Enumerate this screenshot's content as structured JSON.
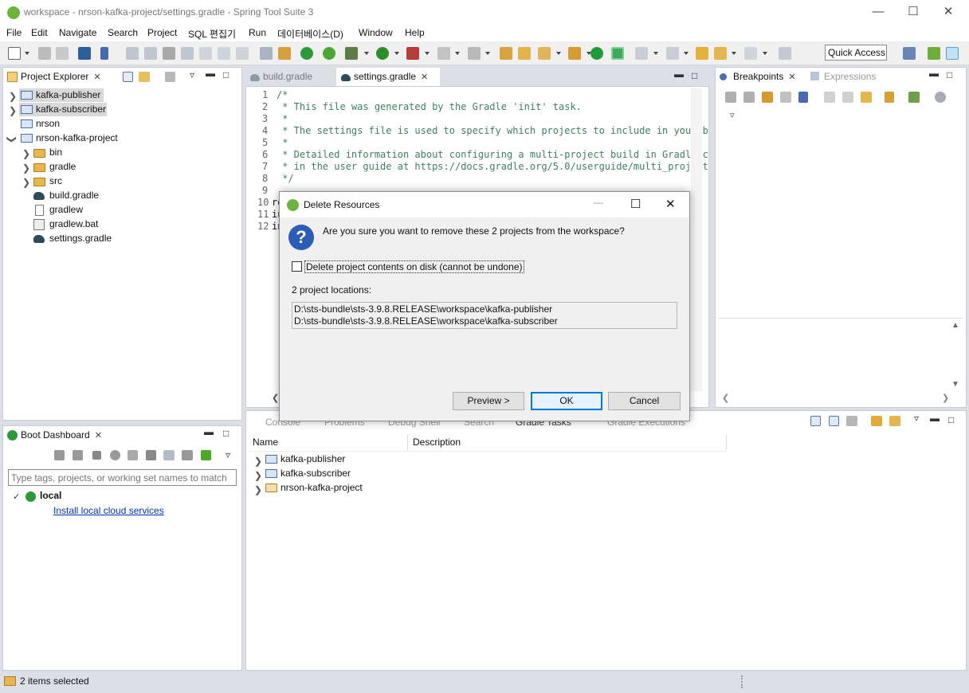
{
  "window": {
    "title": "workspace - nrson-kafka-project/settings.gradle - Spring Tool Suite 3"
  },
  "menu": [
    "File",
    "Edit",
    "Navigate",
    "Search",
    "Project",
    "SQL 편집기",
    "Run",
    "데이터베이스(D)",
    "Window",
    "Help"
  ],
  "toolbar": {
    "quick_access": "Quick Access"
  },
  "project_explorer": {
    "tab_label": "Project Explorer",
    "items": [
      {
        "label": "kafka-publisher",
        "selected": true
      },
      {
        "label": "kafka-subscriber",
        "selected": true
      },
      {
        "label": "nrson"
      },
      {
        "label": "nrson-kafka-project"
      },
      {
        "label": "bin"
      },
      {
        "label": "gradle"
      },
      {
        "label": "src"
      },
      {
        "label": "build.gradle"
      },
      {
        "label": "gradlew"
      },
      {
        "label": "gradlew.bat"
      },
      {
        "label": "settings.gradle"
      }
    ]
  },
  "editor": {
    "tabs": [
      {
        "label": "build.gradle"
      },
      {
        "label": "settings.gradle",
        "active": true
      }
    ],
    "lines": [
      {
        "num": "1",
        "text": "/*"
      },
      {
        "num": "2",
        "text": " * This file was generated by the Gradle 'init' task."
      },
      {
        "num": "3",
        "text": " *"
      },
      {
        "num": "4",
        "text": " * The settings file is used to specify which projects to include in your b"
      },
      {
        "num": "5",
        "text": " *"
      },
      {
        "num": "6",
        "text": " * Detailed information about configuring a multi-project build in Gradle c"
      },
      {
        "num": "7",
        "text": " * in the user guide at https://docs.gradle.org/5.0/userguide/multi_project"
      },
      {
        "num": "8",
        "text": " */"
      },
      {
        "num": "9",
        "text": ""
      },
      {
        "num": "10",
        "text": "ro"
      },
      {
        "num": "11",
        "text": "in"
      },
      {
        "num": "12",
        "text": "in"
      }
    ]
  },
  "right_panel": {
    "tabs": [
      {
        "label": "Breakpoints",
        "active": true
      },
      {
        "label": "Expressions"
      }
    ]
  },
  "boot_dashboard": {
    "tab_label": "Boot Dashboard",
    "filter_placeholder": "Type tags, projects, or working set names to match",
    "local_label": "local",
    "install_link": "Install local cloud services"
  },
  "bottom_panel": {
    "tabs": [
      "Console",
      "Problems",
      "Debug Shell",
      "Search",
      "Gradle Tasks",
      "Gradle Executions"
    ],
    "columns": [
      "Name",
      "Description"
    ],
    "rows": [
      "kafka-publisher",
      "kafka-subscriber",
      "nrson-kafka-project"
    ]
  },
  "dialog": {
    "title": "Delete Resources",
    "question": "Are you sure you want to remove these 2 projects from the workspace?",
    "checkbox_label": "Delete project contents on disk (cannot be undone)",
    "locations_label": "2 project locations:",
    "locations": [
      "D:\\sts-bundle\\sts-3.9.8.RELEASE\\workspace\\kafka-publisher",
      "D:\\sts-bundle\\sts-3.9.8.RELEASE\\workspace\\kafka-subscriber"
    ],
    "buttons": {
      "preview": "Preview >",
      "ok": "OK",
      "cancel": "Cancel"
    }
  },
  "status": {
    "text": "2 items selected"
  },
  "colors": {
    "spring_green": "#6db33f",
    "comment_green": "#3f7f5f",
    "selection_gray": "#d9d9d9",
    "default_button_border": "#0078d7"
  }
}
